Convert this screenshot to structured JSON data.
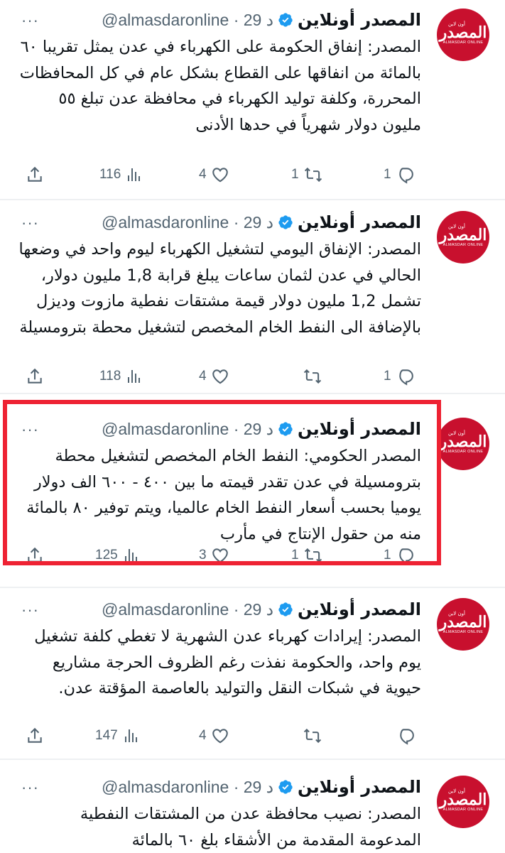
{
  "account": {
    "name": "المصدر أونلاين",
    "handle": "@almasdaronline",
    "time": "29 د",
    "avatar_text_ar": "المصدر",
    "avatar_text_small": "أون لاين",
    "avatar_text_en": "ALMASDAR ONLINE",
    "verified_icon": "verified-badge-icon",
    "brand_color": "#c8102e",
    "verified_color": "#1d9bf0"
  },
  "highlight_color": "#ee2233",
  "tweets": [
    {
      "text": "المصدر: إنفاق الحكومة على الكهرباء في عدن يمثل تقريبا ٦٠ بالمائة من انفاقها على القطاع بشكل عام في كل المحافظات المحررة، وكلفة توليد الكهرباء في محافظة عدن تبلغ ٥٥ مليون دولار شهرياً في حدها الأدنى",
      "replies": "1",
      "retweets": "1",
      "likes": "4",
      "views": "116"
    },
    {
      "text": "المصدر: الإنفاق اليومي لتشغيل الكهرباء ليوم واحد في وضعها الحالي في عدن لثمان ساعات يبلغ قرابة 1,8 مليون دولار، تشمل 1,2 مليون دولار قيمة مشتقات نفطية مازوت وديزل بالإضافة الى النفط الخام المخصص لتشغيل محطة بترومسيلة",
      "replies": "1",
      "retweets": "",
      "likes": "4",
      "views": "118"
    },
    {
      "text": "المصدر الحكومي: النفط الخام المخصص لتشغيل محطة بترومسيلة في عدن تقدر قيمته ما بين ٤٠٠ - ٦٠٠ الف دولار يوميا بحسب أسعار النفط الخام عالميا، ويتم توفير ٨٠ بالمائة منه من حقول الإنتاج في مأرب",
      "replies": "1",
      "retweets": "1",
      "likes": "3",
      "views": "125"
    },
    {
      "text": "المصدر: إيرادات كهرباء عدن الشهرية لا تغطي كلفة تشغيل يوم واحد، والحكومة نفذت رغم الظروف الحرجة مشاريع حيوية في شبكات النقل والتوليد بالعاصمة المؤقتة عدن.",
      "replies": "",
      "retweets": "",
      "likes": "4",
      "views": "147"
    },
    {
      "text": "المصدر: نصيب محافظة عدن من المشتقات النفطية المدعومة المقدمة من الأشقاء بلغ ٦٠ بالمائة",
      "replies": "",
      "retweets": "",
      "likes": "",
      "views": ""
    }
  ]
}
